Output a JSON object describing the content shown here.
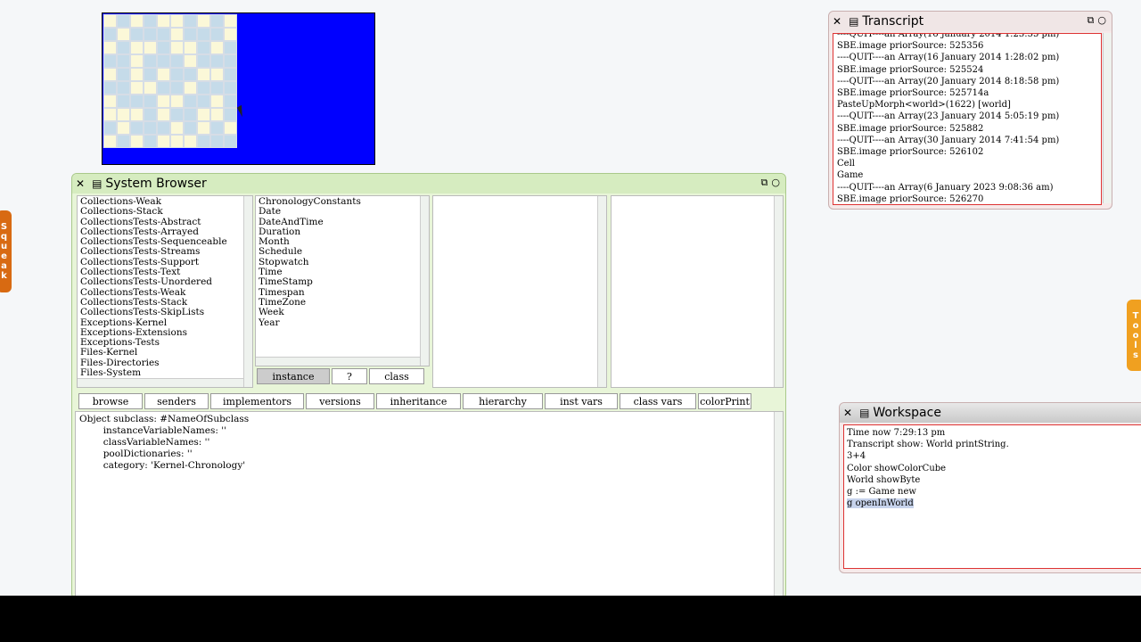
{
  "flaps": {
    "squeak": "Squeak",
    "tools": "Tools"
  },
  "game": {
    "board": [
      [
        0,
        1,
        0,
        1,
        0,
        0,
        1,
        0,
        1,
        0
      ],
      [
        1,
        0,
        1,
        1,
        1,
        0,
        1,
        1,
        1,
        0
      ],
      [
        0,
        1,
        0,
        0,
        1,
        0,
        0,
        1,
        0,
        1
      ],
      [
        1,
        1,
        0,
        1,
        1,
        1,
        0,
        1,
        1,
        1
      ],
      [
        0,
        1,
        0,
        1,
        0,
        1,
        1,
        0,
        0,
        1
      ],
      [
        1,
        1,
        0,
        0,
        1,
        1,
        0,
        1,
        1,
        1
      ],
      [
        0,
        1,
        1,
        1,
        0,
        0,
        1,
        1,
        0,
        1
      ],
      [
        0,
        0,
        0,
        1,
        0,
        1,
        1,
        0,
        0,
        1
      ],
      [
        1,
        0,
        1,
        1,
        1,
        0,
        1,
        0,
        1,
        0
      ],
      [
        0,
        1,
        0,
        1,
        0,
        0,
        0,
        1,
        1,
        1
      ]
    ]
  },
  "browser": {
    "title": "System Browser",
    "packages": [
      "Collections-Weak",
      "Collections-Stack",
      "CollectionsTests-Abstract",
      "CollectionsTests-Arrayed",
      "CollectionsTests-Sequenceable",
      "CollectionsTests-Streams",
      "CollectionsTests-Support",
      "CollectionsTests-Text",
      "CollectionsTests-Unordered",
      "CollectionsTests-Weak",
      "CollectionsTests-Stack",
      "CollectionsTests-SkipLists",
      "Exceptions-Kernel",
      "Exceptions-Extensions",
      "Exceptions-Tests",
      "Files-Kernel",
      "Files-Directories",
      "Files-System"
    ],
    "classes": [
      "ChronologyConstants",
      "Date",
      "DateAndTime",
      "Duration",
      "Month",
      "Schedule",
      "Stopwatch",
      "Time",
      "TimeStamp",
      "Timespan",
      "TimeZone",
      "Week",
      "Year"
    ],
    "mode_buttons": [
      "instance",
      "?",
      "class"
    ],
    "buttons": [
      "browse",
      "senders",
      "implementors",
      "versions",
      "inheritance",
      "hierarchy",
      "inst vars",
      "class vars",
      "colorPrint"
    ],
    "code": "Object subclass: #NameOfSubclass\n\tinstanceVariableNames: ''\n\tclassVariableNames: ''\n\tpoolDictionaries: ''\n\tcategory: 'Kernel-Chronology'"
  },
  "transcript": {
    "title": "Transcript",
    "text": "----QUIT----an Array(16 January 2014 1:23:55 pm)\nSBE.image priorSource: 525356\n----QUIT----an Array(16 January 2014 1:28:02 pm)\nSBE.image priorSource: 525524\n----QUIT----an Array(20 January 2014 8:18:58 pm)\nSBE.image priorSource: 525714a\nPasteUpMorph<world>(1622) [world]\n----QUIT----an Array(23 January 2014 5:05:19 pm)\nSBE.image priorSource: 525882\n----QUIT----an Array(30 January 2014 7:41:54 pm)\nSBE.image priorSource: 526102\nCell\nGame\n----QUIT----an Array(6 January 2023 9:08:36 am)\nSBE.image priorSource: 526270"
  },
  "workspace": {
    "title": "Workspace",
    "lines": [
      "Time now 7:29:13 pm",
      "Transcript show: World printString.",
      "3+4",
      "Color showColorCube",
      "World showByte",
      "g := Game new"
    ],
    "selected_line": "g openInWorld"
  }
}
